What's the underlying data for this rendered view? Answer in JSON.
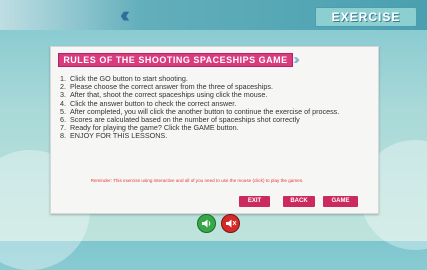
{
  "header": {
    "exercise_label": "EXERCISE"
  },
  "panel": {
    "title": "RULES OF THE SHOOTING SPACESHIPS GAME",
    "rules": [
      {
        "num": "1.",
        "text": "Click the GO button to start shooting."
      },
      {
        "num": "2.",
        "text": "Please choose the correct answer from the three of spaceships."
      },
      {
        "num": "3.",
        "text": "After that, shoot the correct spaceships using click the mouse."
      },
      {
        "num": "4.",
        "text": "Click the answer button to check the correct answer."
      },
      {
        "num": "5.",
        "text": "After completed, you will click the another button to continue the exercise of process."
      },
      {
        "num": "6.",
        "text": "Scores are calculated based on the number of spaceships shot correctly"
      },
      {
        "num": "7.",
        "text": "Ready for playing the game? Click the GAME button."
      },
      {
        "num": "8.",
        "text": "ENJOY FOR THIS LESSONS."
      }
    ],
    "reminder": "Reminder: This exercise using interactive and all of you need to use the mouse (click) to play the games."
  },
  "buttons": {
    "exit": "EXIT",
    "back": "BACK",
    "game": "GAME"
  },
  "colors": {
    "accent": "#d93b7f",
    "button": "#cc2a5f",
    "sound_on": "#37a84a",
    "sound_off": "#d42a2a"
  },
  "icons": {
    "sound_on": "speaker-on-icon",
    "sound_off": "speaker-off-icon"
  }
}
